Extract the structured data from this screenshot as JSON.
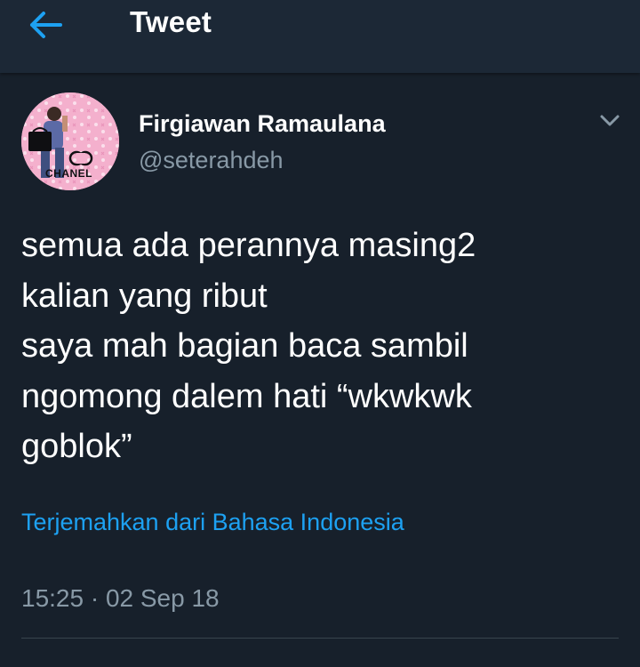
{
  "header": {
    "title": "Tweet",
    "back_icon": "arrow-left-icon",
    "back_color": "#1da1f2"
  },
  "tweet": {
    "author_name": "Firgiawan Ramaulana",
    "author_handle": "@seterahdeh",
    "avatar_text": "CHANEL",
    "text": "semua ada perannya masing2\nkalian yang ribut\nsaya mah bagian baca sambil\nngomong dalem hati “wkwkwk\ngoblok”",
    "translate_link": "Terjemahkan dari Bahasa Indonesia",
    "timestamp": "15:25 · 02 Sep 18",
    "more_icon": "chevron-down-icon"
  },
  "colors": {
    "background": "#17202b",
    "header_background": "#1c2836",
    "text_primary": "#ffffff",
    "text_secondary": "#8899a6",
    "link": "#1da1f2",
    "divider": "#38444d"
  }
}
